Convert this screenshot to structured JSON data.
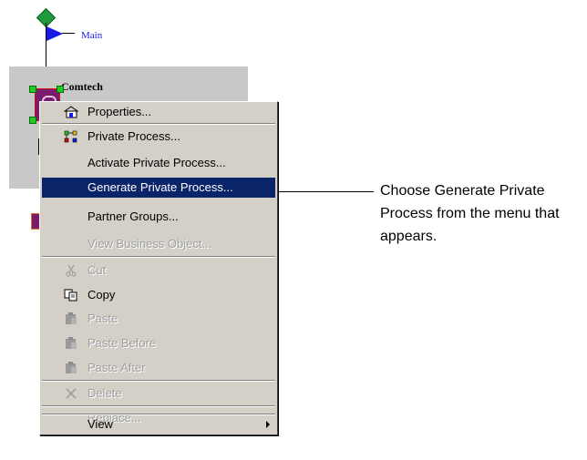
{
  "diagram": {
    "main_label": "Main",
    "node_label": "Comtech"
  },
  "menu": {
    "items": [
      {
        "label": "Properties...",
        "icon": "properties-icon",
        "state": "enabled"
      },
      {
        "label": "Private Process...",
        "icon": "private-process-icon",
        "state": "enabled"
      },
      {
        "label": "Activate Private Process...",
        "icon": "",
        "state": "enabled"
      },
      {
        "label": "Generate Private Process...",
        "icon": "",
        "state": "highlighted"
      },
      {
        "label": "Partner Groups...",
        "icon": "",
        "state": "enabled"
      },
      {
        "label": "View Business Object...",
        "icon": "",
        "state": "disabled"
      },
      {
        "label": "Cut",
        "icon": "scissors-icon",
        "state": "disabled"
      },
      {
        "label": "Copy",
        "icon": "copy-icon",
        "state": "enabled"
      },
      {
        "label": "Paste",
        "icon": "clipboard-icon",
        "state": "disabled"
      },
      {
        "label": "Paste Before",
        "icon": "clipboard-icon",
        "state": "disabled"
      },
      {
        "label": "Paste After",
        "icon": "clipboard-icon",
        "state": "disabled"
      },
      {
        "label": "Delete",
        "icon": "delete-x-icon",
        "state": "disabled"
      },
      {
        "label": "Replace...",
        "icon": "",
        "state": "disabled"
      },
      {
        "label": "View",
        "icon": "",
        "state": "enabled",
        "submenu": true
      }
    ]
  },
  "callout": {
    "text": "Choose Generate Private Process from the menu that appears."
  },
  "colors": {
    "menu_bg": "#d4d0c8",
    "highlight_bg": "#0a246a",
    "highlight_text": "#ffffff",
    "disabled_text": "#a0a0a0",
    "main_label": "#1a1ae6",
    "start_node": "#1f9a3a"
  }
}
